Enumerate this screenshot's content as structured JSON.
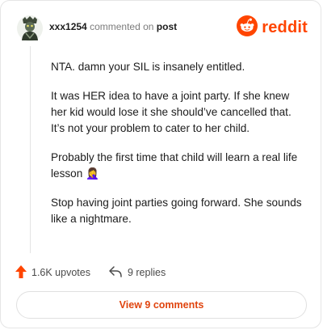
{
  "header": {
    "username": "xxx1254",
    "action_text": "commented on",
    "post_link": "post",
    "brand": "reddit"
  },
  "comment": {
    "paragraphs": [
      "NTA. damn your SIL is insanely entitled.",
      "It was HER idea to have a joint party. If she knew her kid would lose it she should’ve cancelled that. It’s not your problem to cater to her child.",
      "Probably the first time that child will learn a real life lesson",
      "Stop having joint parties going forward. She sounds like a nightmare."
    ],
    "emoji": "🤦‍♀️"
  },
  "actions": {
    "upvotes": "1.6K upvotes",
    "replies": "9 replies"
  },
  "footer": {
    "view_comments": "View 9 comments"
  },
  "colors": {
    "brand": "#ff4500",
    "accent_text": "#e0440e"
  },
  "icons": [
    "avatar",
    "reddit-logo-icon",
    "upvote-arrow-icon",
    "reply-icon",
    "facepalm-emoji"
  ]
}
